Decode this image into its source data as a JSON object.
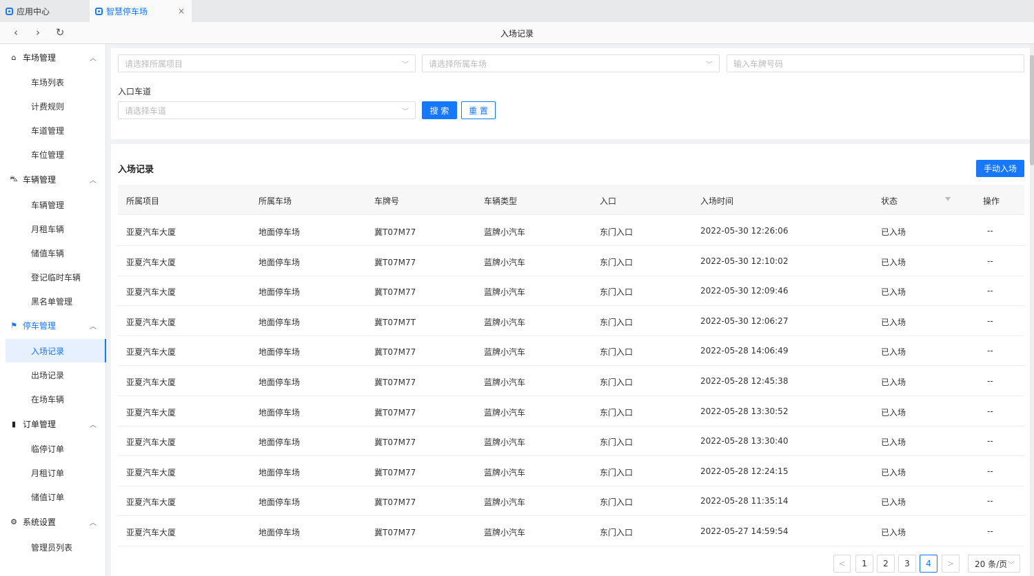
{
  "tabs": [
    {
      "label": "应用中心",
      "icon": "app-center-icon"
    },
    {
      "label": "智慧停车场",
      "icon": "parking-icon",
      "close": "×"
    }
  ],
  "nav": {
    "back": "‹",
    "forward": "›",
    "refresh": "↻",
    "title": "入场记录"
  },
  "sidebar": {
    "groups": [
      {
        "label": "车场管理",
        "icon": "parking-lot-icon",
        "glyph": "⌂",
        "chevron": "︿",
        "items": [
          "车场列表",
          "计费规则",
          "车道管理",
          "车位管理"
        ]
      },
      {
        "label": "车辆管理",
        "icon": "car-icon",
        "glyph": "⛍",
        "chevron": "︿",
        "items": [
          "车辆管理",
          "月租车辆",
          "储值车辆",
          "登记临时车辆",
          "黑名单管理"
        ]
      },
      {
        "label": "停车管理",
        "icon": "parking-manage-icon",
        "glyph": "⚑",
        "chevron": "︿",
        "items": [
          "入场记录",
          "出场记录",
          "在场车辆"
        ]
      },
      {
        "label": "订单管理",
        "icon": "order-icon",
        "glyph": "▮",
        "chevron": "︿",
        "items": [
          "临停订单",
          "月租订单",
          "储值订单"
        ]
      },
      {
        "label": "系统设置",
        "icon": "gear-icon",
        "glyph": "⚙",
        "chevron": "︿",
        "items": [
          "管理员列表"
        ]
      }
    ],
    "active_item": "入场记录"
  },
  "filters": {
    "project_placeholder": "请选择所属项目",
    "lot_placeholder": "请选择所属车场",
    "plate_placeholder": "输入车牌号码",
    "lane_label": "入口车道",
    "lane_placeholder": "请选择车道",
    "dropdown_arrow": "﹀",
    "search_label": "搜 索",
    "reset_label": "重 置"
  },
  "table": {
    "title": "入场记录",
    "manual_entry_label": "手动入场",
    "columns": [
      "所属项目",
      "所属车场",
      "车牌号",
      "车辆类型",
      "入口",
      "入场时间",
      "状态",
      "操作"
    ],
    "rows": [
      [
        "亚夏汽车大厦",
        "地面停车场",
        "冀T07M77",
        "蓝牌小汽车",
        "东门入口",
        "2022-05-30 12:26:06",
        "已入场",
        "--"
      ],
      [
        "亚夏汽车大厦",
        "地面停车场",
        "冀T07M77",
        "蓝牌小汽车",
        "东门入口",
        "2022-05-30 12:10:02",
        "已入场",
        "--"
      ],
      [
        "亚夏汽车大厦",
        "地面停车场",
        "冀T07M77",
        "蓝牌小汽车",
        "东门入口",
        "2022-05-30 12:09:46",
        "已入场",
        "--"
      ],
      [
        "亚夏汽车大厦",
        "地面停车场",
        "冀T07M7T",
        "蓝牌小汽车",
        "东门入口",
        "2022-05-30 12:06:27",
        "已入场",
        "--"
      ],
      [
        "亚夏汽车大厦",
        "地面停车场",
        "冀T07M77",
        "蓝牌小汽车",
        "东门入口",
        "2022-05-28 14:06:49",
        "已入场",
        "--"
      ],
      [
        "亚夏汽车大厦",
        "地面停车场",
        "冀T07M77",
        "蓝牌小汽车",
        "东门入口",
        "2022-05-28 12:45:38",
        "已入场",
        "--"
      ],
      [
        "亚夏汽车大厦",
        "地面停车场",
        "冀T07M77",
        "蓝牌小汽车",
        "东门入口",
        "2022-05-28 13:30:52",
        "已入场",
        "--"
      ],
      [
        "亚夏汽车大厦",
        "地面停车场",
        "冀T07M77",
        "蓝牌小汽车",
        "东门入口",
        "2022-05-28 13:30:40",
        "已入场",
        "--"
      ],
      [
        "亚夏汽车大厦",
        "地面停车场",
        "冀T07M77",
        "蓝牌小汽车",
        "东门入口",
        "2022-05-28 12:24:15",
        "已入场",
        "--"
      ],
      [
        "亚夏汽车大厦",
        "地面停车场",
        "冀T07M77",
        "蓝牌小汽车",
        "东门入口",
        "2022-05-28 11:35:14",
        "已入场",
        "--"
      ],
      [
        "亚夏汽车大厦",
        "地面停车场",
        "冀T07M77",
        "蓝牌小汽车",
        "东门入口",
        "2022-05-27 14:59:54",
        "已入场",
        "--"
      ]
    ]
  },
  "pagination": {
    "prev": "<",
    "next": ">",
    "pages": [
      "1",
      "2",
      "3",
      "4"
    ],
    "current": "4",
    "page_size": "20 条/页",
    "page_size_arrow": "﹀"
  },
  "colors": {
    "primary": "#1677ff"
  }
}
